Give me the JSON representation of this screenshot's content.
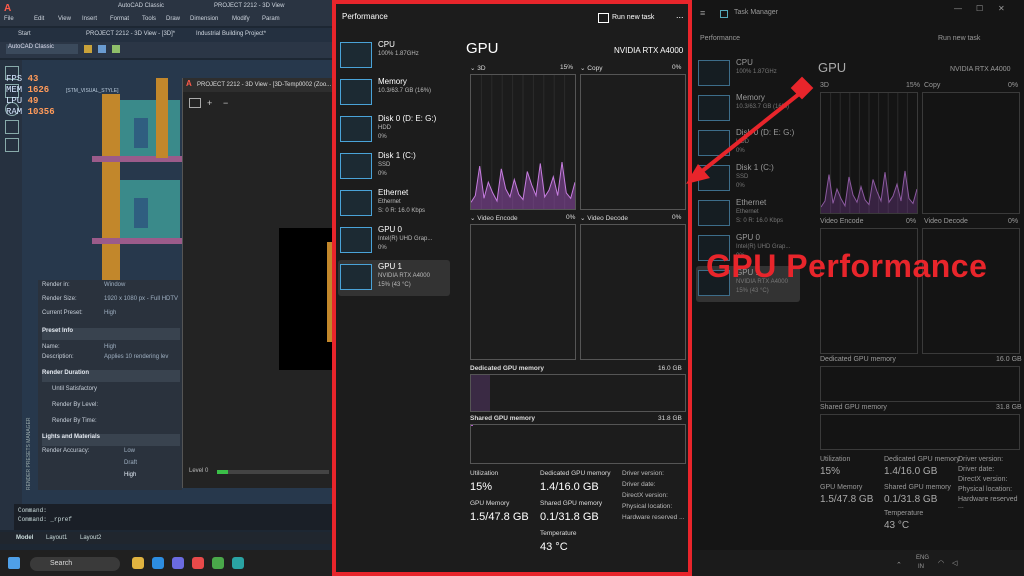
{
  "autocad": {
    "menu": [
      "File",
      "Edit",
      "View",
      "Insert",
      "Format",
      "Tools",
      "Draw",
      "Dimension",
      "Modify",
      "Param"
    ],
    "workspace": "AutoCAD Classic",
    "title": "PROJECT 2212 - 3D View",
    "tabs": [
      "Start",
      "PROJECT 2212 - 3D View - [3D]*",
      "Industrial Building Project*"
    ],
    "style_box": "AutoCAD Classic",
    "viewport_label": "[STM_VISUAL_STYLE]",
    "stats": [
      {
        "key": "FPS",
        "value": "43"
      },
      {
        "key": "MEM",
        "value": "1626"
      },
      {
        "key": "LPU",
        "value": "49"
      },
      {
        "key": "RAM",
        "value": "10356"
      }
    ],
    "render_window_title": "PROJECT 2212 - 3D View - [3D-Temp0002 (Zoo...",
    "presets": {
      "render_in_label": "Render in:",
      "render_in_value": "Window",
      "render_size_label": "Render Size:",
      "render_size_value": "1920 x 1080 px - Full HDTV",
      "current_preset_label": "Current Preset:",
      "current_preset_value": "High",
      "preset_info_header": "Preset Info",
      "name_label": "Name:",
      "name_value": "High",
      "description_label": "Description:",
      "description_value": "Applies 10 rendering lev",
      "render_duration_header": "Render Duration",
      "until_satisfactory": "Until Satisfactory",
      "render_by_level": "Render By Level:",
      "render_by_time": "Render By Time:",
      "lights_header": "Lights and Materials",
      "render_accuracy_label": "Render Accuracy:",
      "accuracy_low": "Low",
      "accuracy_draft": "Draft",
      "accuracy_high": "High",
      "side_label": "RENDER PRESETS MANAGER"
    },
    "level_label": "Level 0",
    "command_lines": [
      "Command:",
      "Command: _rpref"
    ],
    "model_tabs": [
      "Model",
      "Layout1",
      "Layout2"
    ],
    "taskbar_search": "Search"
  },
  "task_manager": {
    "section_title": "Performance",
    "run_new_task": "Run new task",
    "more": "...",
    "sidebar": [
      {
        "name": "CPU",
        "line1": "100% 1.87GHz",
        "line2": ""
      },
      {
        "name": "Memory",
        "line1": "10.3/63.7 GB (16%)",
        "line2": ""
      },
      {
        "name": "Disk 0 (D: E: G:)",
        "line1": "HDD",
        "line2": "0%"
      },
      {
        "name": "Disk 1 (C:)",
        "line1": "SSD",
        "line2": "0%"
      },
      {
        "name": "Ethernet",
        "line1": "Ethernet",
        "line2": "S: 0 R: 16.0 Kbps"
      },
      {
        "name": "GPU 0",
        "line1": "Intel(R) UHD Grap...",
        "line2": "0%"
      },
      {
        "name": "GPU 1",
        "line1": "NVIDIA RTX A4000",
        "line2": "15% (43 °C)"
      }
    ],
    "gpu_title": "GPU",
    "gpu_model": "NVIDIA RTX A4000",
    "engines": [
      {
        "name": "3D",
        "percent": "15%"
      },
      {
        "name": "Copy",
        "percent": "0%"
      },
      {
        "name": "Video Encode",
        "percent": "0%"
      },
      {
        "name": "Video Decode",
        "percent": "0%"
      }
    ],
    "dedicated_label": "Dedicated GPU memory",
    "dedicated_max": "16.0 GB",
    "shared_label": "Shared GPU memory",
    "shared_max": "31.8 GB",
    "stats": {
      "utilization_label": "Utilization",
      "utilization_value": "15%",
      "dedicated_mem_label": "Dedicated GPU memory",
      "dedicated_mem_value": "1.4/16.0 GB",
      "gpu_memory_label": "GPU Memory",
      "gpu_memory_value": "1.5/47.8 GB",
      "shared_mem_label": "Shared GPU memory",
      "shared_mem_value": "0.1/31.8 GB",
      "temperature_label": "Temperature",
      "temperature_value": "43 °C",
      "driver_version_label": "Driver version:",
      "driver_date_label": "Driver date:",
      "directx_label": "DirectX version:",
      "physical_location_label": "Physical location:",
      "hardware_reserved_label": "Hardware reserved ..."
    },
    "graph_3d_load": [
      0.05,
      0.1,
      0.32,
      0.08,
      0.2,
      0.12,
      0.06,
      0.3,
      0.15,
      0.09,
      0.22,
      0.11,
      0.07,
      0.28,
      0.18,
      0.1,
      0.34,
      0.09,
      0.14,
      0.24,
      0.1,
      0.35,
      0.12,
      0.08,
      0.2
    ],
    "dedicated_fill": 0.09,
    "shared_fill": 0.01
  },
  "task_manager_bg": {
    "window_title": "Task Manager",
    "section_title": "Performance",
    "run_new_task": "Run new task",
    "sidebar_short": [
      {
        "name": "CPU",
        "line1": "100% 1.87GHz"
      },
      {
        "name": "Memory",
        "line1": "10.3/63.7 GB (16%)"
      },
      {
        "name": "Disk 0 (D: E: G:)",
        "line1": "HDD",
        "line2": "0%"
      },
      {
        "name": "Disk 1 (C:)",
        "line1": "SSD",
        "line2": "0%"
      },
      {
        "name": "Ethernet",
        "line1": "Ethernet",
        "line2": "S: 0 R: 16.0 Kbps"
      },
      {
        "name": "GPU 0",
        "line1": "Intel(R) UHD Grap...",
        "line2": "0%"
      },
      {
        "name": "GPU 1",
        "line1": "NVIDIA RTX A4000",
        "line2": "15% (43 °C)"
      }
    ],
    "gpu_title": "GPU",
    "gpu_model": "NVIDIA RTX A4000",
    "engine_3d": "3D",
    "engine_3d_pct": "15%",
    "engine_copy": "Copy",
    "engine_copy_pct": "0%",
    "engine_encode": "Video Encode",
    "engine_encode_pct": "0%",
    "engine_decode": "Video Decode",
    "engine_decode_pct": "0%",
    "dedicated_label": "Dedicated GPU memory",
    "dedicated_max": "16.0 GB",
    "shared_label": "Shared GPU memory",
    "shared_max": "31.8 GB",
    "utilization_label": "Utilization",
    "utilization_value": "15%",
    "dedicated_mem_label": "Dedicated GPU memory",
    "dedicated_mem_value": "1.4/16.0 GB",
    "gpu_memory_label": "GPU Memory",
    "gpu_memory_value": "1.5/47.8 GB",
    "shared_mem_label": "Shared GPU memory",
    "shared_mem_value": "0.1/31.8 GB",
    "temperature_label": "Temperature",
    "temperature_value": "43 °C",
    "driver_version_label": "Driver version:",
    "driver_date_label": "Driver date:",
    "directx_label": "DirectX version:",
    "physical_location_label": "Physical location:",
    "hardware_reserved_label": "Hardware reserved ...",
    "tray_lang": "ENG",
    "tray_region": "IN"
  },
  "annotation": {
    "text": "GPU Performance",
    "color": "#e8252b"
  }
}
